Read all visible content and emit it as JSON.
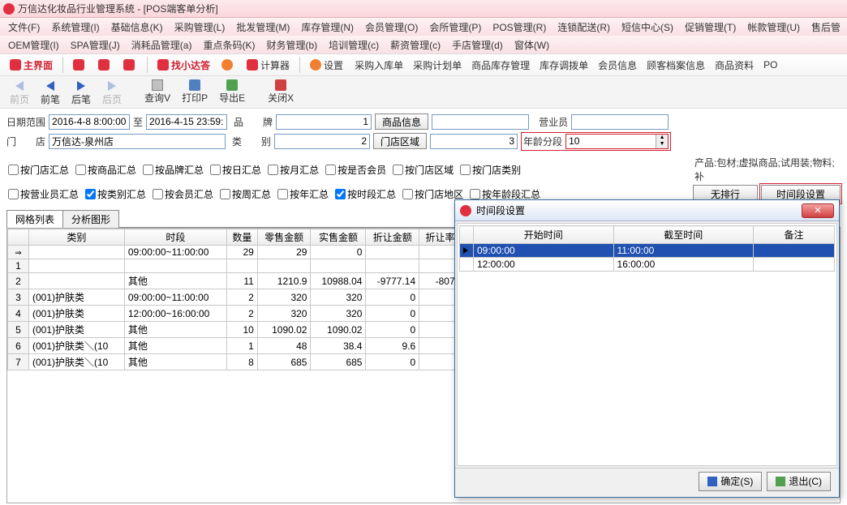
{
  "window": {
    "title": "万信达化妆品行业管理系统 - [POS端客单分析]"
  },
  "menubar1": [
    "文件(F)",
    "系统管理(I)",
    "基础信息(K)",
    "采购管理(L)",
    "批发管理(M)",
    "库存管理(N)",
    "会员管理(O)",
    "会所管理(P)",
    "POS管理(R)",
    "连锁配送(R)",
    "短信中心(S)",
    "促销管理(T)",
    "帐款管理(U)",
    "售后管"
  ],
  "menubar2": [
    "OEM管理(I)",
    "SPA管理(J)",
    "消耗品管理(a)",
    "重点条码(K)",
    "财务管理(b)",
    "培训管理(c)",
    "薪资管理(c)",
    "手店管理(d)",
    "窗体(W)"
  ],
  "toolbar1": {
    "main": "主界面",
    "find": "找小达答",
    "calc": "计算器",
    "settings": "设置",
    "items": [
      "采购入库单",
      "采购计划单",
      "商品库存管理",
      "库存调拨单",
      "会员信息",
      "顾客档案信息",
      "商品资料",
      "PO"
    ]
  },
  "toolbar2": {
    "first": "前页",
    "prev": "前笔",
    "next": "后笔",
    "last": "后页",
    "query": "查询V",
    "print": "打印P",
    "export": "导出E",
    "close": "关闭X"
  },
  "filters": {
    "dateRangeLabel": "日期范围",
    "dateFrom": "2016-4-8 8:00:00",
    "dateToLabel": "至",
    "dateTo": "2016-4-15 23:59:",
    "brandLabel": "品　　牌",
    "brandVal": "1",
    "productInfoBtn": "商品信息",
    "salesLabel": "营业员",
    "storeLabel": "门　　店",
    "storeVal": "万信达-泉州店",
    "catLabel": "类　　别",
    "catVal": "2",
    "storeAreaBtn": "门店区域",
    "areaVal": "3",
    "ageLabel": "年龄分段",
    "ageVal": "10"
  },
  "checks": {
    "r1": [
      "按门店汇总",
      "按商品汇总",
      "按品牌汇总",
      "按日汇总",
      "按月汇总",
      "按是否会员",
      "按门店区域",
      "按门店类别"
    ],
    "r2": [
      "按营业员汇总",
      "按类别汇总",
      "按会员汇总",
      "按周汇总",
      "按年汇总",
      "按时段汇总",
      "按门店地区",
      "按年龄段汇总"
    ],
    "checked": [
      "按类别汇总",
      "按时段汇总"
    ],
    "productLabel": "产品:包材;虚拟商品;试用装;物料;补",
    "noRankBtn": "无排行",
    "timeSettingBtn": "时间段设置"
  },
  "tabs": {
    "grid": "网格列表",
    "chart": "分析图形"
  },
  "grid": {
    "headers": [
      "",
      "类别",
      "时段",
      "数量",
      "零售金额",
      "实售金额",
      "折让金额",
      "折让率"
    ],
    "rows": [
      {
        "n": "",
        "cat": "",
        "slot": "09:00:00~11:00:00",
        "qty": "29",
        "retail": "29",
        "actual": "0",
        "disc": "",
        "rate": ""
      },
      {
        "n": "1",
        "cat": "",
        "slot": "",
        "qty": "",
        "retail": "",
        "actual": "",
        "disc": "",
        "rate": ""
      },
      {
        "n": "2",
        "cat": "",
        "slot": "其他",
        "qty": "11",
        "retail": "1210.9",
        "actual": "10988.04",
        "disc": "-9777.14",
        "rate": "-807."
      },
      {
        "n": "3",
        "cat": "(001)护肤类",
        "slot": "09:00:00~11:00:00",
        "qty": "2",
        "retail": "320",
        "actual": "320",
        "disc": "0",
        "rate": ""
      },
      {
        "n": "4",
        "cat": "(001)护肤类",
        "slot": "12:00:00~16:00:00",
        "qty": "2",
        "retail": "320",
        "actual": "320",
        "disc": "0",
        "rate": ""
      },
      {
        "n": "5",
        "cat": "(001)护肤类",
        "slot": "其他",
        "qty": "10",
        "retail": "1090.02",
        "actual": "1090.02",
        "disc": "0",
        "rate": ""
      },
      {
        "n": "6",
        "cat": "(001)护肤类＼(10",
        "slot": "其他",
        "qty": "1",
        "retail": "48",
        "actual": "38.4",
        "disc": "9.6",
        "rate": ""
      },
      {
        "n": "7",
        "cat": "(001)护肤类＼(10",
        "slot": "其他",
        "qty": "8",
        "retail": "685",
        "actual": "685",
        "disc": "0",
        "rate": ""
      }
    ]
  },
  "dialog": {
    "title": "时间段设置",
    "headers": [
      "开始时间",
      "截至时间",
      "备注"
    ],
    "rows": [
      {
        "start": "09:00:00",
        "end": "11:00:00",
        "note": "",
        "sel": true
      },
      {
        "start": "12:00:00",
        "end": "16:00:00",
        "note": "",
        "sel": false
      }
    ],
    "okBtn": "确定(S)",
    "exitBtn": "退出(C)"
  }
}
